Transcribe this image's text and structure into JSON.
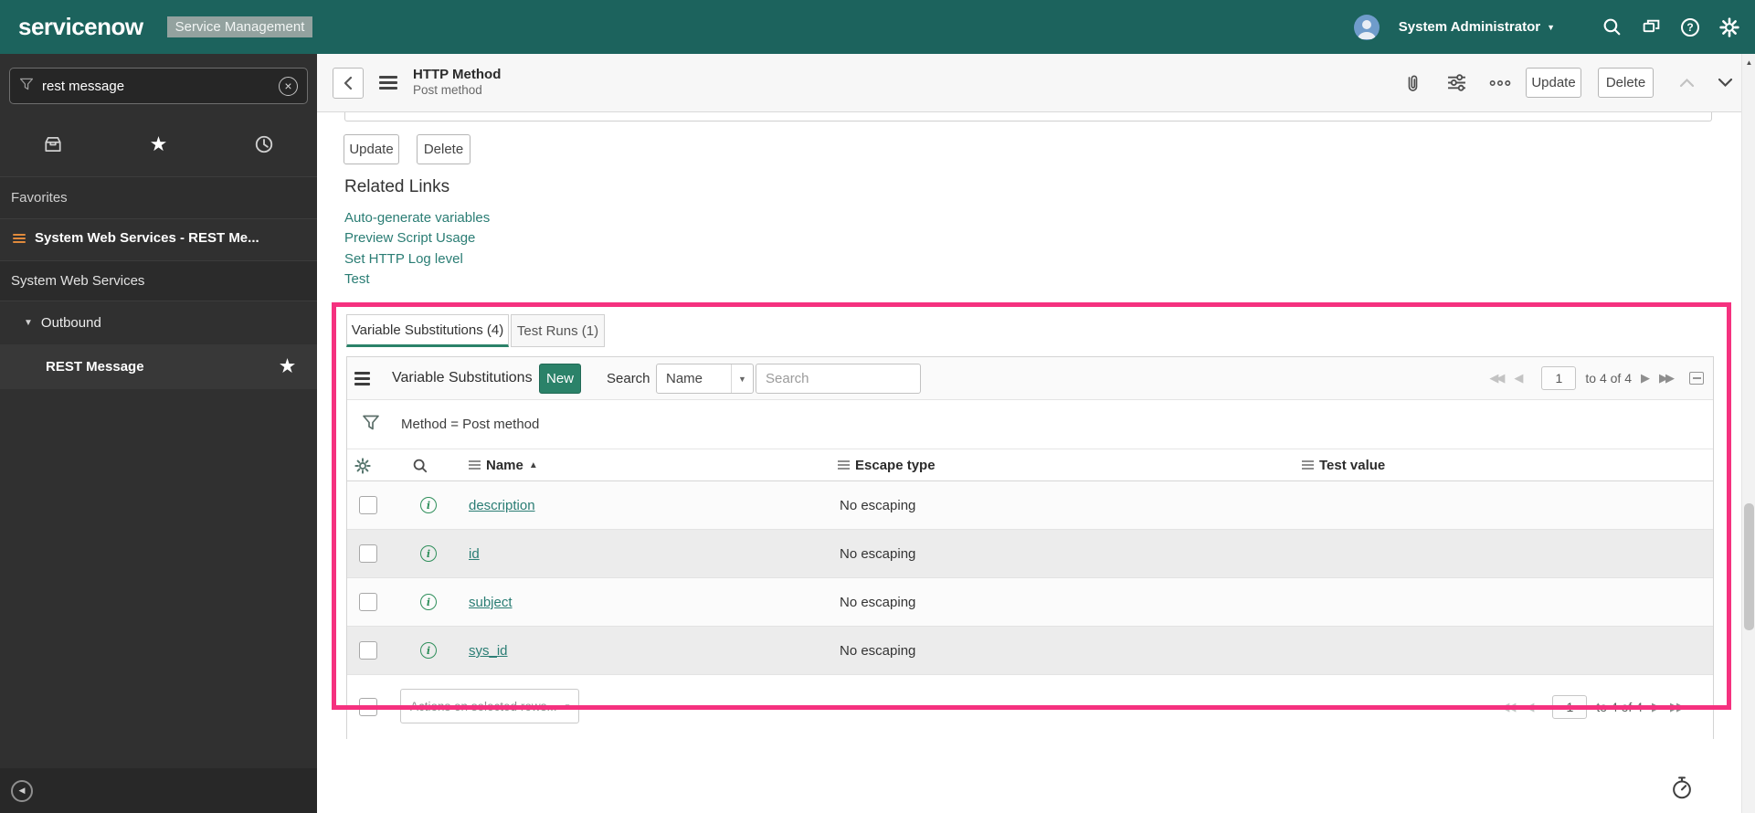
{
  "colors": {
    "header_bg": "#1c635d",
    "accent": "#2b8269",
    "link": "#2a7d74",
    "annotation": "#f5317f",
    "info_icon": "#2f8f5b"
  },
  "icons": {
    "caret_down": "▼",
    "sort_asc": "▲",
    "star": "★",
    "clear_x": "×",
    "help_q": "?",
    "page_first": "◀◀",
    "page_prev": "◀",
    "page_next": "▶",
    "page_last": "▶▶",
    "info_i": "i",
    "collapse_left": "◀",
    "scroll_up": "▲"
  },
  "header": {
    "logo": "servicenow",
    "app_label": "Service Management",
    "user": "System Administrator"
  },
  "sidebar": {
    "search_value": "rest message",
    "favorites_label": "Favorites",
    "favorite_item": "System Web Services - REST Me...",
    "app_section": "System Web Services",
    "outbound_label": "Outbound",
    "module_label": "REST Message"
  },
  "form_header": {
    "title": "HTTP Method",
    "subtitle": "Post method",
    "update_label": "Update",
    "delete_label": "Delete"
  },
  "content": {
    "update_label": "Update",
    "delete_label": "Delete",
    "related_links_title": "Related Links",
    "related_links": [
      "Auto-generate variables",
      "Preview Script Usage",
      "Set HTTP Log level",
      "Test"
    ]
  },
  "tabs": [
    {
      "label": "Variable Substitutions (4)"
    },
    {
      "label": "Test Runs (1)"
    }
  ],
  "list": {
    "title": "Variable Substitutions",
    "new_label": "New",
    "search_label": "Search",
    "search_field": "Name",
    "search_placeholder": "Search",
    "breadcrumb": "Method = Post method",
    "pagination": {
      "page": "1",
      "range": "to 4 of 4"
    },
    "columns": [
      "Name",
      "Escape type",
      "Test value"
    ],
    "rows": [
      {
        "name": "description",
        "escape_type": "No escaping",
        "test_value": ""
      },
      {
        "name": "id",
        "escape_type": "No escaping",
        "test_value": ""
      },
      {
        "name": "subject",
        "escape_type": "No escaping",
        "test_value": ""
      },
      {
        "name": "sys_id",
        "escape_type": "No escaping",
        "test_value": ""
      }
    ],
    "footer": {
      "actions_label": "Actions on selected rows..."
    }
  }
}
